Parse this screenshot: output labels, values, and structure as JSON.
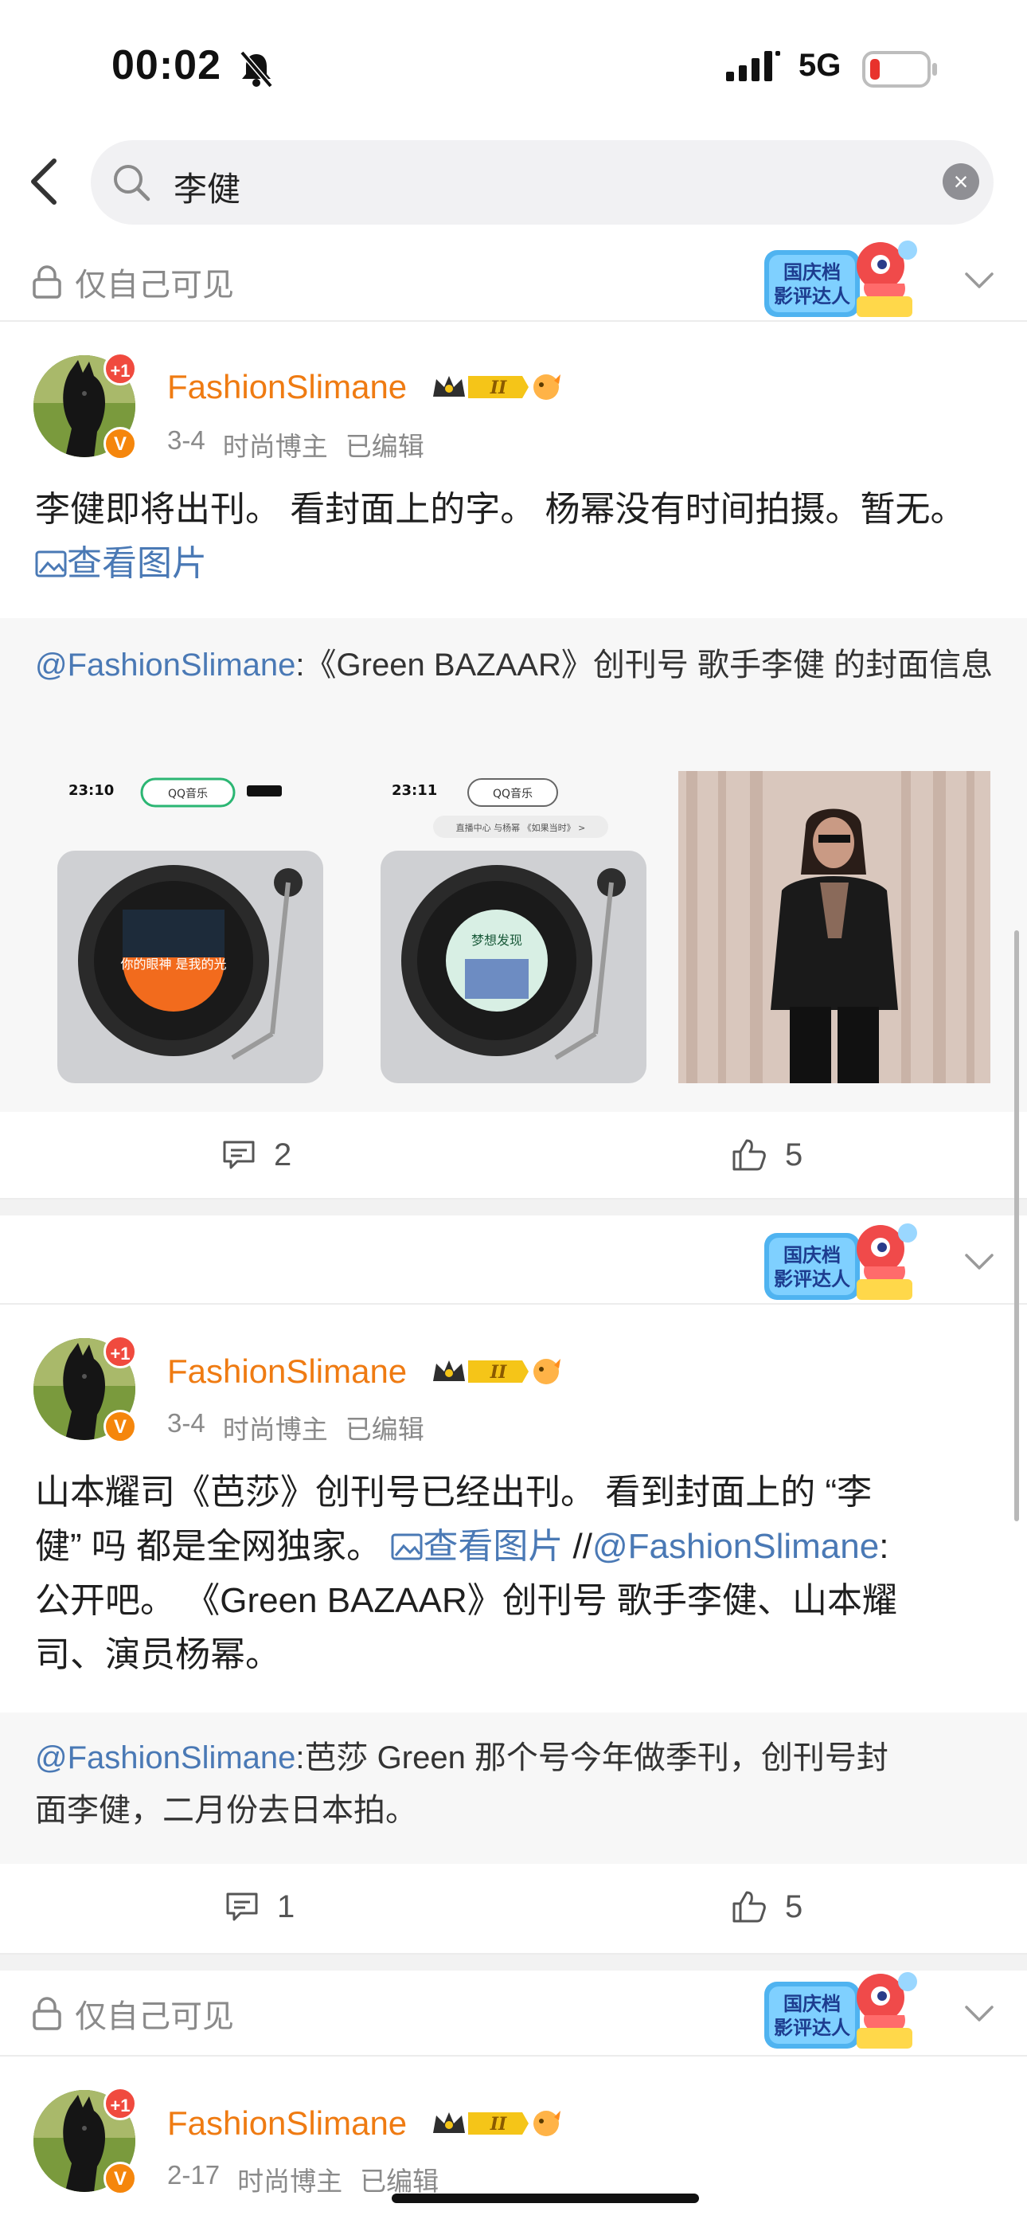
{
  "status_bar": {
    "time": "00:02",
    "network": "5G",
    "battery_color": "#e8322c"
  },
  "search": {
    "query": "李健"
  },
  "posts": [
    {
      "privacy": "仅自己可见",
      "user": "FashionSlimane",
      "date": "3-4",
      "category": "时尚博主",
      "edited": "已编辑",
      "text": "李健即将出刊。 看封面上的字。 杨幂没有时间拍摄。暂无。",
      "image_link": "查看图片",
      "repost_user": "@FashionSlimane",
      "repost_text": ":《Green BAZAAR》创刊号 歌手李健  的封面信息",
      "thumb1": {
        "time": "23:10",
        "pill": "QQ音乐",
        "disc_text": "你的眼神 是我的光"
      },
      "thumb2": {
        "time": "23:11",
        "pill": "QQ音乐",
        "pill2": "直播中心 与杨幂 《如果当时》 >",
        "disc_text": "梦想发现"
      },
      "comments": "2",
      "likes": "5"
    },
    {
      "user": "FashionSlimane",
      "date": "3-4",
      "category": "时尚博主",
      "edited": "已编辑",
      "text_lines": [
        "山本耀司《芭莎》创刊号已经出刊。 看到封面上的 “李",
        "健” 吗 都是全网独家。 ",
        "公开吧。 《Green BAZAAR》创刊号 歌手李健、山本耀",
        "司、演员杨幂。"
      ],
      "image_link": "查看图片",
      "mention_prefix": " //",
      "mention": "@FashionSlimane",
      "mention_suffix": ":",
      "repost_user": "@FashionSlimane",
      "repost_text_line1": ":芭莎 Green 那个号今年做季刊，创刊号封",
      "repost_text_line2": "面李健，二月份去日本拍。",
      "comments": "1",
      "likes": "5"
    },
    {
      "privacy": "仅自己可见",
      "user": "FashionSlimane",
      "date": "2-17",
      "category": "时尚博主",
      "edited": "已编辑"
    }
  ],
  "badge": {
    "line1": "国庆档",
    "line2": "影评达人"
  },
  "level_badge": "II",
  "plus_one": "+1",
  "verified": "V"
}
